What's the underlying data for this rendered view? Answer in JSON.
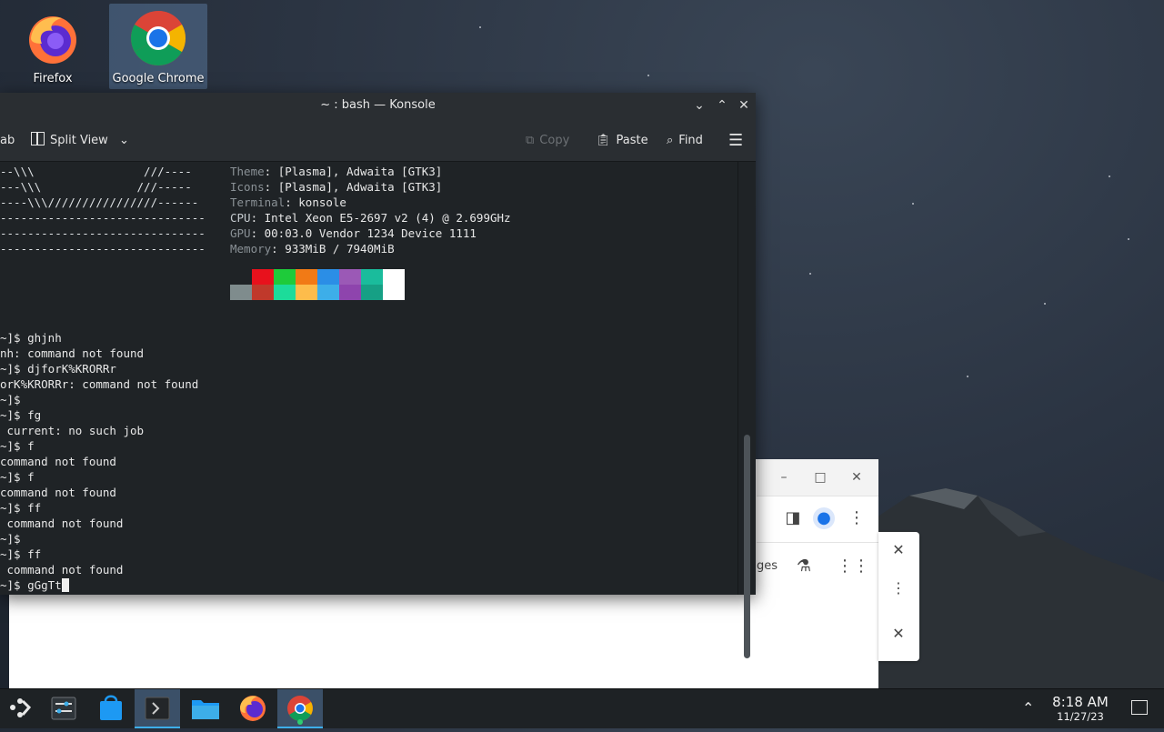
{
  "desktop": {
    "icons": [
      {
        "label": "Firefox"
      },
      {
        "label": "Google Chrome"
      }
    ]
  },
  "konsole": {
    "title": "~ : bash — Konsole",
    "toolbar": {
      "tab_partial": "ab",
      "split_view": "Split View",
      "copy": "Copy",
      "paste": "Paste",
      "find": "Find"
    },
    "logo_lines": [
      "--\\\\\\                ///----",
      "---\\\\\\              ///-----",
      "----\\\\\\////////////////------",
      "------------------------------",
      "------------------------------",
      "------------------------------"
    ],
    "info": [
      {
        "key": "Theme",
        "value": ": [Plasma], Adwaita [GTK3]"
      },
      {
        "key": "Icons",
        "value": ": [Plasma], Adwaita [GTK3]"
      },
      {
        "key": "Terminal",
        "value": ": konsole"
      },
      {
        "key": "CPU",
        "value": ": Intel Xeon E5-2697 v2 (4) @ 2.699GHz"
      },
      {
        "key": "GPU",
        "value": ": 00:03.0 Vendor 1234 Device 1111"
      },
      {
        "key": "Memory",
        "value": ": 933MiB / 7940MiB"
      }
    ],
    "palette_top": [
      "#1f2326",
      "#e8111c",
      "#1ecb3a",
      "#f17a16",
      "#2b8ee6",
      "#9b59b6",
      "#1abc9c",
      "#ffffff"
    ],
    "palette_bottom": [
      "#7f8c8d",
      "#c0392b",
      "#1cdc9a",
      "#fdbc4b",
      "#3daee9",
      "#8e44ad",
      "#16a085",
      "#ffffff"
    ],
    "history": [
      "~]$ ghjnh",
      "nh: command not found",
      "~]$ djforK%KRORRr",
      "orK%KRORRr: command not found",
      "~]$",
      "~]$ fg",
      " current: no such job",
      "~]$ f",
      "command not found",
      "~]$ f",
      "command not found",
      "~]$ ff",
      " command not found",
      "~]$",
      "~]$ ff",
      " command not found"
    ],
    "prompt": "~]$ gGgTt"
  },
  "chrome": {
    "partial_text": "ges"
  },
  "taskbar": {
    "time": "8:18 AM",
    "date": "11/27/23"
  }
}
